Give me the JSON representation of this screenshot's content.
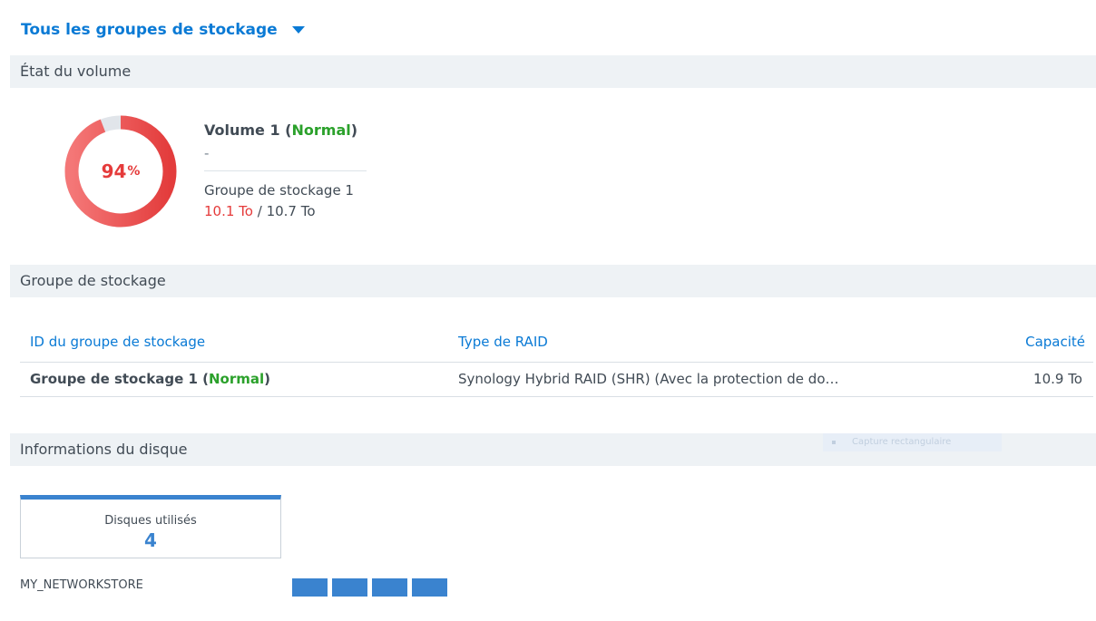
{
  "pool_selector": {
    "label": "Tous les groupes de stockage"
  },
  "sections": {
    "volume_status": "État du volume",
    "storage_pool": "Groupe de stockage",
    "disk_info": "Informations du disque"
  },
  "volume": {
    "usage_percent": 94,
    "percent_value": "94",
    "percent_sign": "%",
    "name": "Volume 1",
    "status": "Normal",
    "description": "-",
    "pool": "Groupe de stockage 1",
    "used": "10.1 To",
    "separator": " / ",
    "total": "10.7 To",
    "ring_color": "#e53b3b",
    "ring_track_color": "#e1e5ea"
  },
  "pool_table": {
    "columns": [
      "ID du groupe de stockage",
      "Type de RAID",
      "Capacité"
    ],
    "rows": [
      {
        "id": "Groupe de stockage 1",
        "status": "Normal",
        "raid": "Synology Hybrid RAID (SHR) (Avec la protection de do…",
        "capacity": "10.9 To"
      }
    ]
  },
  "overlay": {
    "text": "Capture rectangulaire"
  },
  "disks": {
    "card_title": "Disques utilisés",
    "count": "4",
    "host": "MY_NETWORKSTORE",
    "bar_color": "#3a83cf"
  },
  "colors": {
    "accent": "#0a7ad5",
    "status_ok": "#2ba12b",
    "danger": "#e53b3b",
    "header_bg": "#eef2f5"
  }
}
